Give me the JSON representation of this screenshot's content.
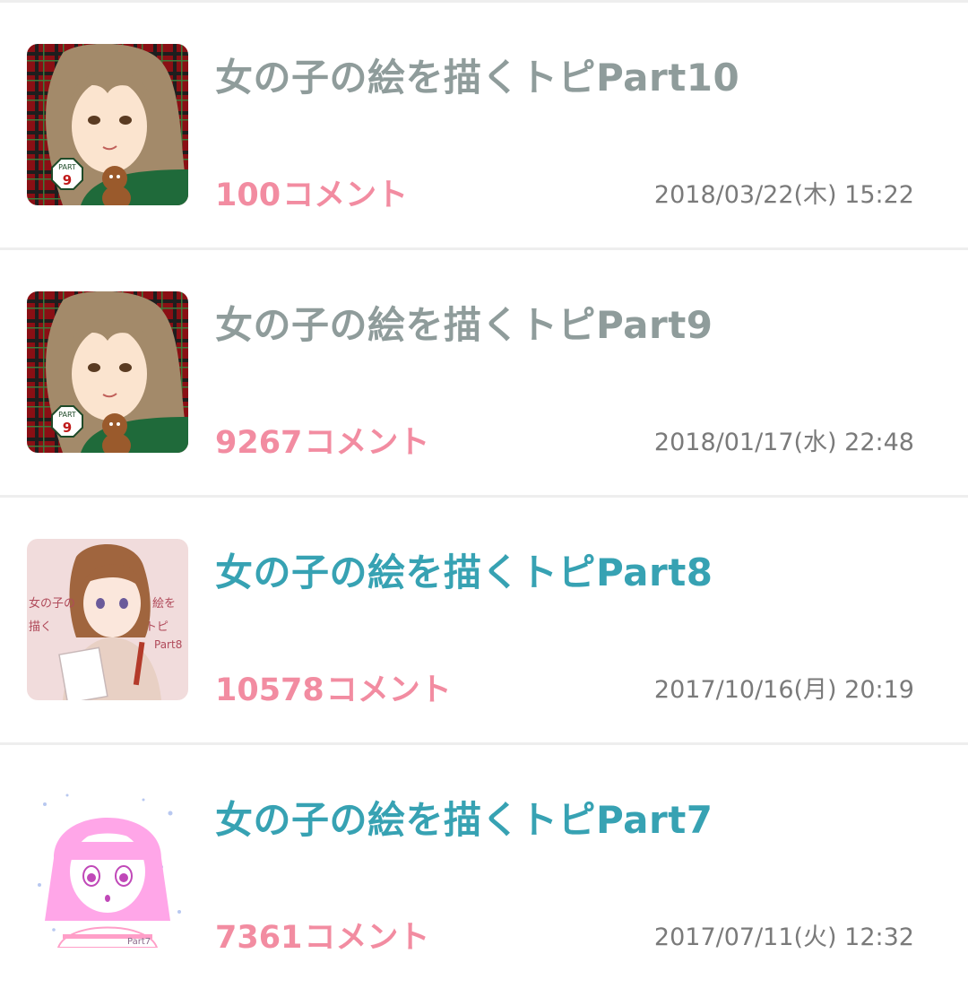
{
  "threads": [
    {
      "title": "女の子の絵を描くトピPart10",
      "comment_count": "100",
      "comment_suffix": "コメント",
      "date": "2018/03/22(木) 15:22",
      "visited": true,
      "thumbnail": "plaid-girl-gingerbread",
      "badge_word": "PART",
      "badge_number": "9"
    },
    {
      "title": "女の子の絵を描くトピPart9",
      "comment_count": "9267",
      "comment_suffix": "コメント",
      "date": "2018/01/17(水) 22:48",
      "visited": true,
      "thumbnail": "plaid-girl-gingerbread",
      "badge_word": "PART",
      "badge_number": "9"
    },
    {
      "title": "女の子の絵を描くトピPart8",
      "comment_count": "10578",
      "comment_suffix": "コメント",
      "date": "2017/10/16(月) 20:19",
      "visited": false,
      "thumbnail": "girl-with-paper-pink",
      "thumb_text_left": "女の子の",
      "thumb_text_right": "絵を",
      "thumb_text_2left": "描く",
      "thumb_text_2right": "トピ",
      "thumb_text_part": "Part8"
    },
    {
      "title": "女の子の絵を描くトピPart7",
      "comment_count": "7361",
      "comment_suffix": "コメント",
      "date": "2017/07/11(火) 12:32",
      "visited": false,
      "thumbnail": "pink-hair-girl-sparkles",
      "thumb_text_part": "Part7"
    }
  ],
  "colors": {
    "title_visited": "#8f9c9b",
    "title_unvisited": "#37a2b3",
    "comments": "#f28ca1",
    "date": "#7a7a7a",
    "divider": "#eeeeee"
  }
}
